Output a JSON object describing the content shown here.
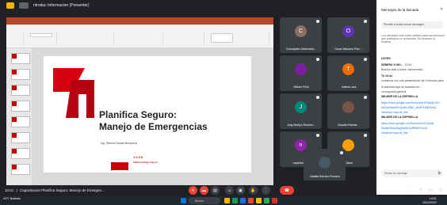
{
  "window": {
    "title": "ntroduc Informacion (Presenter)"
  },
  "slide": {
    "title_line1": "Planifica Seguro:",
    "title_line2": "Manejo de Emergencias",
    "subtitle": "Ing. Sebera Garcia Mosquera",
    "phone": "1 0 0 0",
    "website": "www.ccmarp.org.co"
  },
  "participants": [
    {
      "name": "Concejales Veterinaria...",
      "initial": "C",
      "color": "#8d6e63"
    },
    {
      "name": "Oscar Mauricio Pino ...",
      "initial": "O",
      "color": "#5e35b1"
    },
    {
      "name": "Wilmer ROA",
      "initial": "",
      "color": "#7b1fa2"
    },
    {
      "name": "Valeria Lara",
      "initial": "T",
      "color": "#ef6c00"
    },
    {
      "name": "Judy Marilyn Romero...",
      "initial": "J",
      "color": "#00897b"
    },
    {
      "name": "Claudia Patricia ...",
      "initial": "",
      "color": "#795548"
    },
    {
      "name": "nayelishanda",
      "initial": "n",
      "color": "#8e24aa"
    },
    {
      "name": "Diana",
      "initial": "",
      "color": "#ffa000"
    },
    {
      "name": "Natalia Serrano Romero",
      "initial": "",
      "color": "#455a64"
    }
  ],
  "chat": {
    "title": "Mensajes de la llamada",
    "toggle_label": "Permitir a todos enviar mensajes",
    "system_note": "Los mensajes solo estan visibles para las personas que participan en la llamada. Se borraran al finalizar.",
    "messages": [
      {
        "sender": "USTED",
        "time": "",
        "text": ""
      },
      {
        "sender": "SEBERA G MO...",
        "time": "10:40",
        "text": "Buenos dias a todos, bienvenidos"
      },
      {
        "sender": "Tu 10:44",
        "time": "",
        "text": "contamos con una presentacion de 5 minutos para"
      },
      {
        "sender": "",
        "time": "",
        "text": "la actividad que se realizara en..."
      },
      {
        "sender": "",
        "time": "",
        "text": "cronograma general"
      },
      {
        "sender": "WILMER DE LA ESPRIELLA",
        "time": "",
        "text": ""
      },
      {
        "sender": "",
        "time": "",
        "text": "https://docs.google.com/forms/d/e/1FAIpQLScV"
      },
      {
        "sender": "",
        "time": "",
        "text": "kUZvk3hwrdhXQz3mJD82_2hMfTHSjf7SwQ"
      },
      {
        "sender": "",
        "time": "",
        "text": "viewform?usp=sf_link"
      },
      {
        "sender": "WILMER DE LA ESPRIELLA",
        "time": "",
        "text": ""
      },
      {
        "sender": "",
        "time": "",
        "text": "https://docs.google.com/forms/d/e/1FAIpQL"
      },
      {
        "sender": "",
        "time": "",
        "text": "Sdx8W3x6UBgQsn8ZQzRt5WCe4vA"
      },
      {
        "sender": "",
        "time": "",
        "text": "viewform?usp=sf_link"
      }
    ],
    "input_placeholder": "Enviar un mensaje"
  },
  "meeting": {
    "time": "10:51",
    "name": "Capacitacion Planifica Seguro: Manejo de Emergen..."
  },
  "controls": [
    {
      "name": "mic-off-icon",
      "glyph": "✕"
    },
    {
      "name": "camera-off-icon",
      "glyph": "▬"
    },
    {
      "name": "captions-icon",
      "glyph": "▤"
    },
    {
      "name": "emoji-icon",
      "glyph": "☺"
    },
    {
      "name": "present-icon",
      "glyph": "▣"
    },
    {
      "name": "raise-hand-icon",
      "glyph": "✋"
    },
    {
      "name": "more-options-icon",
      "glyph": "⋮"
    }
  ],
  "taskbar": {
    "weather": "24°C Nublado",
    "search_placeholder": "Buscar",
    "time": "10:51",
    "date": "20/10/2023"
  },
  "colors": {
    "accent_red": "#ea4335",
    "ppt_red": "#b7472a",
    "meet_bg": "#202124"
  }
}
